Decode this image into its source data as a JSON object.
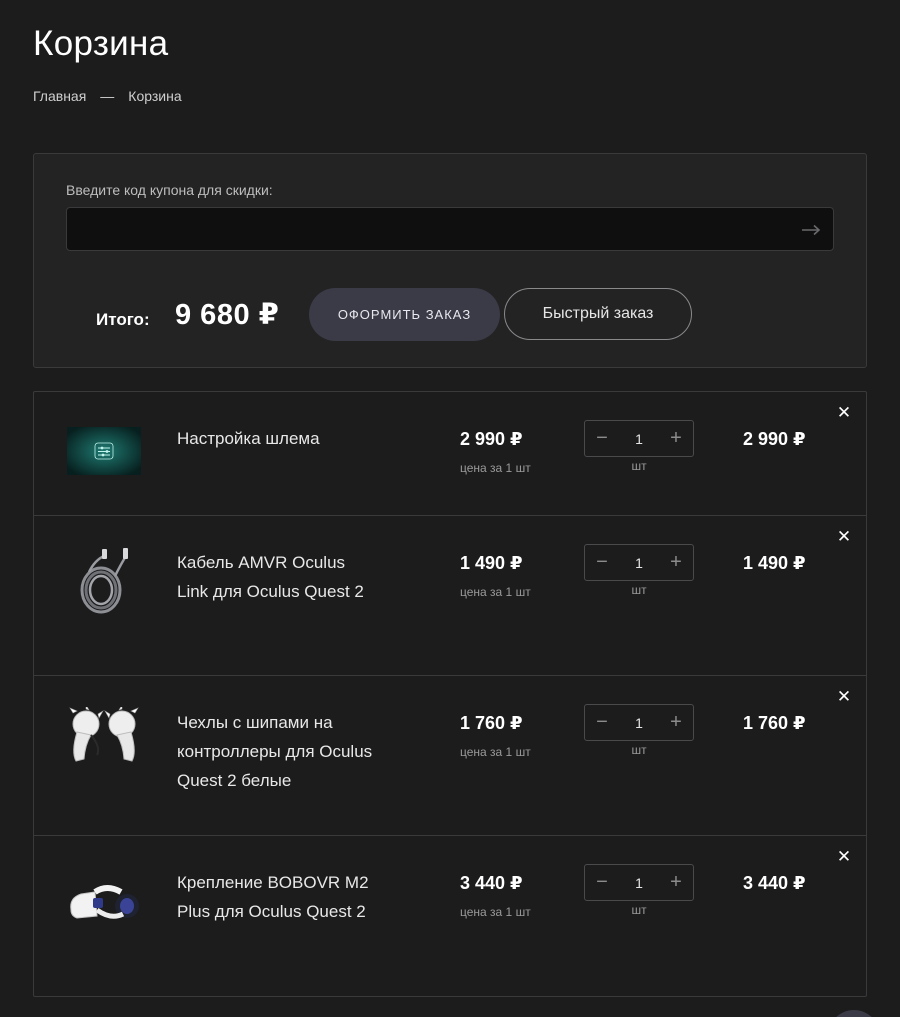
{
  "page": {
    "title": "Корзина",
    "breadcrumb": {
      "home": "Главная",
      "separator": "—",
      "current": "Корзина"
    }
  },
  "coupon": {
    "label": "Введите код купона для скидки:",
    "value": "",
    "placeholder": "",
    "submit_icon": "arrow-right-icon"
  },
  "summary": {
    "total_label": "Итого:",
    "total_value": "9 680 ₽",
    "checkout_label": "ОФОРМИТЬ ЗАКАЗ",
    "quick_order_label": "Быстрый заказ"
  },
  "cart": {
    "items": [
      {
        "name": "Настройка шлема",
        "price": "2 990 ₽",
        "price_note": "цена за 1 шт",
        "quantity": "1",
        "unit": "шт",
        "total": "2 990 ₽",
        "image": "settings-card"
      },
      {
        "name": "Кабель AMVR Oculus Link для Oculus Quest 2",
        "price": "1 490 ₽",
        "price_note": "цена за 1 шт",
        "quantity": "1",
        "unit": "шт",
        "total": "1 490 ₽",
        "image": "cable"
      },
      {
        "name": "Чехлы с шипами на контроллеры для Oculus Quest 2 белые",
        "price": "1 760 ₽",
        "price_note": "цена за 1 шт",
        "quantity": "1",
        "unit": "шт",
        "total": "1 760 ₽",
        "image": "controller-covers"
      },
      {
        "name": "Крепление BOBOVR M2 Plus для Oculus Quest 2",
        "price": "3 440 ₽",
        "price_note": "цена за 1 шт",
        "quantity": "1",
        "unit": "шт",
        "total": "3 440 ₽",
        "image": "head-strap"
      }
    ],
    "minus_symbol": "−",
    "plus_symbol": "+",
    "remove_symbol": "✕"
  },
  "colors": {
    "background": "#1c1c1d",
    "panel": "#232324",
    "border": "#3a3a3c",
    "accent_button": "#3b3b47",
    "text": "#ffffff"
  }
}
